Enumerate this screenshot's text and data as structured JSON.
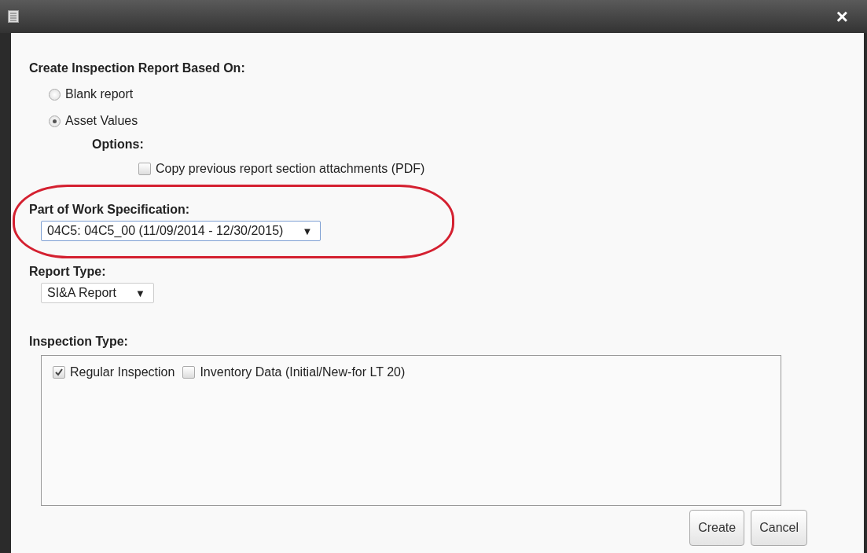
{
  "window": {
    "close": "×"
  },
  "based_on": {
    "label": "Create Inspection Report Based On:",
    "options": [
      {
        "label": "Blank report",
        "selected": false
      },
      {
        "label": "Asset Values",
        "selected": true
      }
    ],
    "options_label": "Options:",
    "attachments": {
      "label": "Copy previous report section attachments (PDF)",
      "checked": false
    }
  },
  "work_spec": {
    "label": "Part of Work Specification:",
    "value": "04C5: 04C5_00 (11/09/2014 - 12/30/2015)",
    "arrow": "▼",
    "highlighted": true
  },
  "report_type": {
    "label": "Report Type:",
    "value": "SI&A Report",
    "arrow": "▼"
  },
  "inspection_type": {
    "label": "Inspection Type:",
    "items": [
      {
        "label": "Regular Inspection",
        "checked": true
      },
      {
        "label": "Inventory Data (Initial/New-for LT 20)",
        "checked": false
      }
    ]
  },
  "buttons": [
    "Create",
    "Cancel"
  ]
}
